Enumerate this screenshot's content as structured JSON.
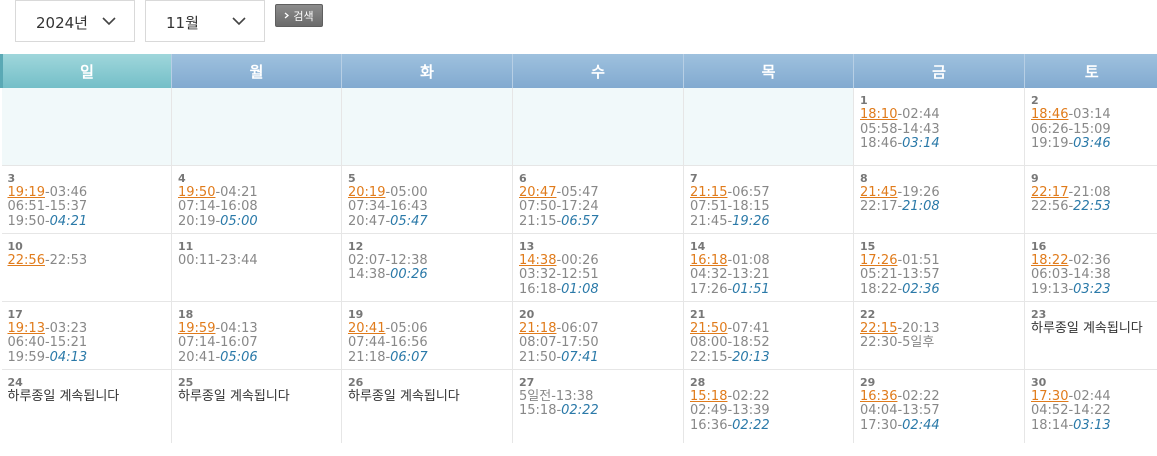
{
  "controls": {
    "year": "2024년",
    "month": "11월",
    "search_label": "검색"
  },
  "weekdays": [
    "일",
    "월",
    "화",
    "수",
    "목",
    "금",
    "토"
  ],
  "weeks": [
    [
      {
        "empty": true
      },
      {
        "empty": true
      },
      {
        "empty": true
      },
      {
        "empty": true
      },
      {
        "empty": true
      },
      {
        "day": "1",
        "lines": [
          {
            "hl": "18:10",
            "rest": "-02:44"
          },
          {
            "plain": "05:58-14:43"
          },
          {
            "pre": "18:46-",
            "it": "03:14"
          }
        ]
      },
      {
        "day": "2",
        "lines": [
          {
            "hl": "18:46",
            "rest": "-03:14"
          },
          {
            "plain": "06:26-15:09"
          },
          {
            "pre": "19:19-",
            "it": "03:46"
          }
        ]
      }
    ],
    [
      {
        "day": "3",
        "lines": [
          {
            "hl": "19:19",
            "rest": "-03:46"
          },
          {
            "plain": "06:51-15:37"
          },
          {
            "pre": "19:50-",
            "it": "04:21"
          }
        ]
      },
      {
        "day": "4",
        "lines": [
          {
            "hl": "19:50",
            "rest": "-04:21"
          },
          {
            "plain": "07:14-16:08"
          },
          {
            "pre": "20:19-",
            "it": "05:00"
          }
        ]
      },
      {
        "day": "5",
        "lines": [
          {
            "hl": "20:19",
            "rest": "-05:00"
          },
          {
            "plain": "07:34-16:43"
          },
          {
            "pre": "20:47-",
            "it": "05:47"
          }
        ]
      },
      {
        "day": "6",
        "lines": [
          {
            "hl": "20:47",
            "rest": "-05:47"
          },
          {
            "plain": "07:50-17:24"
          },
          {
            "pre": "21:15-",
            "it": "06:57"
          }
        ]
      },
      {
        "day": "7",
        "lines": [
          {
            "hl": "21:15",
            "rest": "-06:57"
          },
          {
            "plain": "07:51-18:15"
          },
          {
            "pre": "21:45-",
            "it": "19:26"
          }
        ]
      },
      {
        "day": "8",
        "lines": [
          {
            "hl": "21:45",
            "rest": "-19:26"
          },
          {
            "pre": "22:17-",
            "it": "21:08"
          }
        ]
      },
      {
        "day": "9",
        "lines": [
          {
            "hl": "22:17",
            "rest": "-21:08"
          },
          {
            "pre": "22:56-",
            "it": "22:53"
          }
        ]
      }
    ],
    [
      {
        "day": "10",
        "lines": [
          {
            "hl": "22:56",
            "rest": "-22:53"
          }
        ]
      },
      {
        "day": "11",
        "lines": [
          {
            "plain": "00:11-23:44"
          }
        ]
      },
      {
        "day": "12",
        "lines": [
          {
            "plain": "02:07-12:38"
          },
          {
            "pre": "14:38-",
            "it": "00:26"
          }
        ]
      },
      {
        "day": "13",
        "lines": [
          {
            "hl": "14:38",
            "rest": "-00:26"
          },
          {
            "plain": "03:32-12:51"
          },
          {
            "pre": "16:18-",
            "it": "01:08"
          }
        ]
      },
      {
        "day": "14",
        "lines": [
          {
            "hl": "16:18",
            "rest": "-01:08"
          },
          {
            "plain": "04:32-13:21"
          },
          {
            "pre": "17:26-",
            "it": "01:51"
          }
        ]
      },
      {
        "day": "15",
        "lines": [
          {
            "hl": "17:26",
            "rest": "-01:51"
          },
          {
            "plain": "05:21-13:57"
          },
          {
            "pre": "18:22-",
            "it": "02:36"
          }
        ]
      },
      {
        "day": "16",
        "lines": [
          {
            "hl": "18:22",
            "rest": "-02:36"
          },
          {
            "plain": "06:03-14:38"
          },
          {
            "pre": "19:13-",
            "it": "03:23"
          }
        ]
      }
    ],
    [
      {
        "day": "17",
        "lines": [
          {
            "hl": "19:13",
            "rest": "-03:23"
          },
          {
            "plain": "06:40-15:21"
          },
          {
            "pre": "19:59-",
            "it": "04:13"
          }
        ]
      },
      {
        "day": "18",
        "lines": [
          {
            "hl": "19:59",
            "rest": "-04:13"
          },
          {
            "plain": "07:14-16:07"
          },
          {
            "pre": "20:41-",
            "it": "05:06"
          }
        ]
      },
      {
        "day": "19",
        "lines": [
          {
            "hl": "20:41",
            "rest": "-05:06"
          },
          {
            "plain": "07:44-16:56"
          },
          {
            "pre": "21:18-",
            "it": "06:07"
          }
        ]
      },
      {
        "day": "20",
        "lines": [
          {
            "hl": "21:18",
            "rest": "-06:07"
          },
          {
            "plain": "08:07-17:50"
          },
          {
            "pre": "21:50-",
            "it": "07:41"
          }
        ]
      },
      {
        "day": "21",
        "lines": [
          {
            "hl": "21:50",
            "rest": "-07:41"
          },
          {
            "plain": "08:00-18:52"
          },
          {
            "pre": "22:15-",
            "it": "20:13"
          }
        ]
      },
      {
        "day": "22",
        "lines": [
          {
            "hl": "22:15",
            "rest": "-20:13"
          },
          {
            "plain": "22:30-5일후"
          }
        ]
      },
      {
        "day": "23",
        "lines": [
          {
            "full": "하루종일 계속됩니다"
          }
        ]
      }
    ],
    [
      {
        "day": "24",
        "lines": [
          {
            "full": "하루종일 계속됩니다"
          }
        ]
      },
      {
        "day": "25",
        "lines": [
          {
            "full": "하루종일 계속됩니다"
          }
        ]
      },
      {
        "day": "26",
        "lines": [
          {
            "full": "하루종일 계속됩니다"
          }
        ]
      },
      {
        "day": "27",
        "lines": [
          {
            "plain": "5일전-13:38"
          },
          {
            "pre": "15:18-",
            "it": "02:22"
          }
        ]
      },
      {
        "day": "28",
        "lines": [
          {
            "hl": "15:18",
            "rest": "-02:22"
          },
          {
            "plain": "02:49-13:39"
          },
          {
            "pre": "16:36-",
            "it": "02:22"
          }
        ]
      },
      {
        "day": "29",
        "lines": [
          {
            "hl": "16:36",
            "rest": "-02:22"
          },
          {
            "plain": "04:04-13:57"
          },
          {
            "pre": "17:30-",
            "it": "02:44"
          }
        ]
      },
      {
        "day": "30",
        "lines": [
          {
            "hl": "17:30",
            "rest": "-02:44"
          },
          {
            "plain": "04:52-14:22"
          },
          {
            "pre": "18:14-",
            "it": "03:13"
          }
        ]
      }
    ]
  ]
}
